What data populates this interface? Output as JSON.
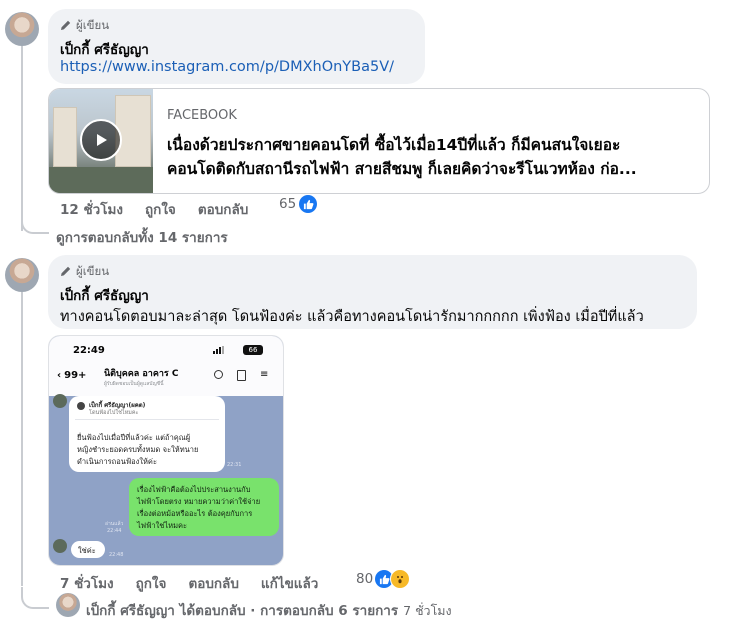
{
  "comment1": {
    "author_tag": "ผู้เขียน",
    "author_name": "เป็กกี้ ศรีธัญญา",
    "link": "https://www.instagram.com/p/DMXhOnYBa5V/",
    "preview": {
      "source": "FACEBOOK",
      "line1": "เนื่องด้วยประกาศขายคอนโดที่ ซื้อไว้เมื่อ14ปีที่แล้ว ก็มีคนสนใจเยอะ",
      "line2": "คอนโดติดกับสถานีรถไฟฟ้า สายสีชมพู ก็เลยคิดว่าจะรีโนเวทห้อง ก่อ..."
    },
    "time": "12 ชั่วโมง",
    "like_label": "ถูกใจ",
    "reply_label": "ตอบกลับ",
    "reaction_count": "65"
  },
  "view_replies": "ดูการตอบกลับทั้ง 14 รายการ",
  "comment2": {
    "author_tag": "ผู้เขียน",
    "author_name": "เป็กกี้ ศรีธัญญา",
    "text": "ทางคอนโดตอบมาละล่าสุด โดนฟ้องค่ะ แล้วคือทางคอนโดน่ารักมากกกกก เพิ่งฟ้อง เมื่อปีที่แล้ว",
    "screenshot": {
      "time": "22:49",
      "battery": "66",
      "back_count": "99+",
      "chat_title": "นิติบุคคล อาคาร C",
      "chat_subtitle": "ผู้รับผิดชอบเป็นผู้ดูแลบัญชีนี้",
      "msg1_name": "เป็กกี้ ศรีธัญญา(ผคต)",
      "msg1_quote": "โดนฟ้องไปใช่ไหมคะ",
      "msg1_body_1": "ยื่นฟ้องไปเมื่อปีที่แล้วค่ะ แต่ถ้าคุณผู้",
      "msg1_body_2": "หญิงชำระยอดครบทั้งหมด จะให้ทนาย",
      "msg1_body_3": "ดำเนินการถอนฟ้องให้ค่ะ",
      "msg1_time": "22:31",
      "msg2_1": "เรื่องไฟฟ้าคือต้องไปประสานงานกับ",
      "msg2_2": "ไฟฟ้าโดยตรง หมายความว่าค่าใช้จ่าย",
      "msg2_3": "เรื่องต่อหม้อหรืออะไร ต้องคุยกับการ",
      "msg2_4": "ไฟฟ้าใช่ไหมคะ",
      "msg2_read": "อ่านแล้ว",
      "msg2_time": "22:44",
      "msg3": "ใช่ค่ะ",
      "msg3_time": "22:48"
    },
    "time": "7 ชั่วโมง",
    "like_label": "ถูกใจ",
    "reply_label": "ตอบกลับ",
    "edited_label": "แก้ไขแล้ว",
    "reaction_count": "80"
  },
  "reply_summary": {
    "text": "เป็กกี้ ศรีธัญญา ได้ตอบกลับ · การตอบกลับ 6 รายการ",
    "time": "7 ชั่วโมง"
  },
  "icons": {
    "author": "pencil-icon",
    "like": "like-icon",
    "wow": "wow-icon",
    "play": "play-icon"
  },
  "colors": {
    "link": "#1b5fb6",
    "like_blue": "#1877f2",
    "chat_green": "#79e26c",
    "chat_bg": "#8fa2c6"
  }
}
